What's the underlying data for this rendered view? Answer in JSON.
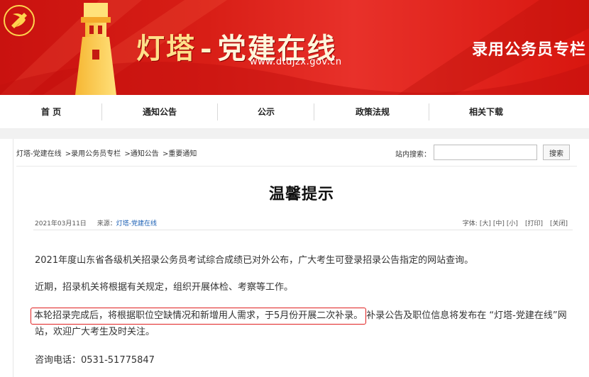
{
  "header": {
    "site_title_main": "灯塔",
    "site_title_dash": "-",
    "site_title_sub": "党建在线",
    "site_url": "www.dtdjzx.gov.cn",
    "column_title": "录用公务员专栏",
    "brand_color": "#d81e16"
  },
  "nav": {
    "items": [
      {
        "label": "首  页"
      },
      {
        "label": "通知公告"
      },
      {
        "label": "公示"
      },
      {
        "label": "政策法规"
      },
      {
        "label": "相关下载"
      }
    ]
  },
  "breadcrumb": {
    "items": [
      "灯塔-党建在线",
      ">录用公务员专栏",
      ">通知公告",
      ">重要通知"
    ]
  },
  "search": {
    "label": "站内搜索：",
    "placeholder": "",
    "button_label": "搜索"
  },
  "article": {
    "title": "温馨提示",
    "date": "2021年03月11日",
    "source_label": "来源：",
    "source": "灯塔-党建在线",
    "font_label": "字体:",
    "font_large": "[大]",
    "font_medium": "[中]",
    "font_small": "[小]",
    "print": "[打印]",
    "close": "[关闭]",
    "paragraphs": [
      "2021年度山东省各级机关招录公务员考试综合成绩已对外公布，广大考生可登录招录公告指定的网站查询。",
      "近期，招录机关将根据有关规定，组织开展体检、考察等工作。"
    ],
    "highlight_text": "本轮招录完成后，将根据职位空缺情况和新增用人需求，于5月份开展二次补录。",
    "p3_rest": "补录公告及职位信息将发布在 “灯塔-党建在线”网站，欢迎广大考生及时关注。",
    "phone": "咨询电话：0531-51775847",
    "highlight_color": "#e02020"
  }
}
